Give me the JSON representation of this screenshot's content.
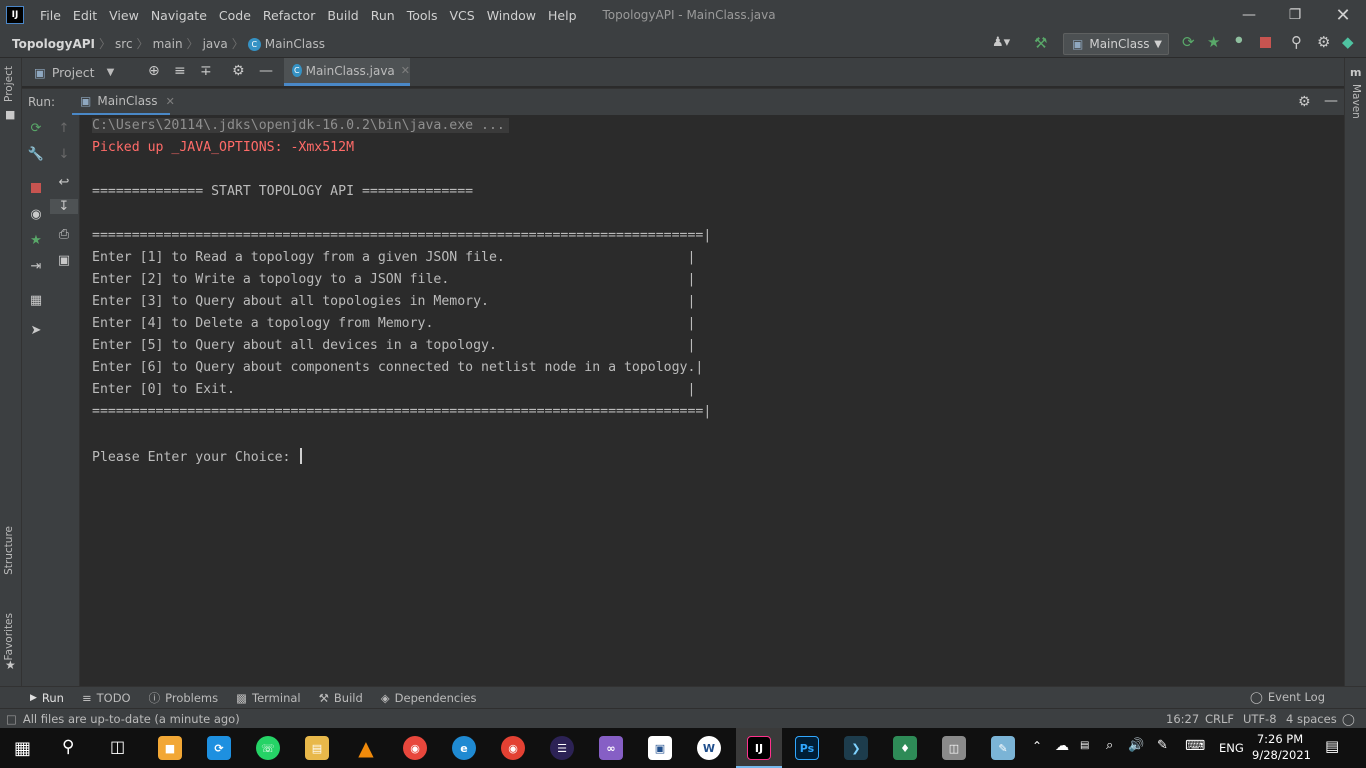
{
  "window": {
    "title": "TopologyAPI - MainClass.java",
    "menus": [
      "File",
      "Edit",
      "View",
      "Navigate",
      "Code",
      "Refactor",
      "Build",
      "Run",
      "Tools",
      "VCS",
      "Window",
      "Help"
    ]
  },
  "breadcrumb": [
    "TopologyAPI",
    "src",
    "main",
    "java",
    "MainClass"
  ],
  "run_config": "MainClass",
  "project_panel": "Project",
  "editor_tab": "MainClass.java",
  "side_tabs": {
    "project": "Project",
    "structure": "Structure",
    "favorites": "Favorites",
    "maven": "Maven"
  },
  "run": {
    "label": "Run:",
    "tab": "MainClass"
  },
  "console": {
    "cmd": "C:\\Users\\20114\\.jdks\\openjdk-16.0.2\\bin\\java.exe ...",
    "warning": "Picked up _JAVA_OPTIONS: -Xmx512M",
    "banner": "============== START TOPOLOGY API ==============",
    "rule_top": "=============================================================================|",
    "options": [
      "Enter [1] to Read a topology from a given JSON file.                       |",
      "Enter [2] to Write a topology to a JSON file.                              |",
      "Enter [3] to Query about all topologies in Memory.                         |",
      "Enter [4] to Delete a topology from Memory.                                |",
      "Enter [5] to Query about all devices in a topology.                        |",
      "Enter [6] to Query about components connected to netlist node in a topology.|",
      "Enter [0] to Exit.                                                         |"
    ],
    "rule_bottom": "=============================================================================|",
    "prompt": "Please Enter your Choice: "
  },
  "bottom_tabs": [
    "Run",
    "TODO",
    "Problems",
    "Terminal",
    "Build",
    "Dependencies"
  ],
  "event_log": "Event Log",
  "status": {
    "message": "All files are up-to-date (a minute ago)",
    "position": "16:27",
    "line_sep": "CRLF",
    "encoding": "UTF-8",
    "indent": "4 spaces"
  },
  "taskbar": {
    "lang": "ENG",
    "time": "7:26 PM",
    "date": "9/28/2021"
  },
  "colors": {
    "accent": "#4a88c7",
    "warning": "#ff6b68",
    "run_green": "#59a869",
    "stop_red": "#c75450"
  }
}
